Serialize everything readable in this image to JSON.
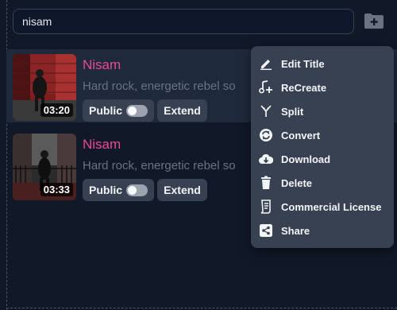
{
  "search": {
    "value": "nisam"
  },
  "songs": [
    {
      "title": "Nisam",
      "description": "Hard rock, energetic rebel so",
      "duration": "03:20",
      "visibility_label": "Public",
      "extend_label": "Extend",
      "public_on": false
    },
    {
      "title": "Nisam",
      "description": "Hard rock, energetic rebel so",
      "duration": "03:33",
      "visibility_label": "Public",
      "extend_label": "Extend",
      "public_on": false
    }
  ],
  "menu": {
    "items": [
      {
        "label": "Edit Title",
        "icon": "pencil-icon"
      },
      {
        "label": "ReCreate",
        "icon": "music-plus-icon"
      },
      {
        "label": "Split",
        "icon": "split-icon"
      },
      {
        "label": "Convert",
        "icon": "convert-icon"
      },
      {
        "label": "Download",
        "icon": "cloud-download-icon"
      },
      {
        "label": "Delete",
        "icon": "trash-icon"
      },
      {
        "label": "Commercial License",
        "icon": "license-icon"
      },
      {
        "label": "Share",
        "icon": "share-icon"
      }
    ]
  },
  "colors": {
    "accent_title": "#ec4899",
    "background": "#111827",
    "menu_bg": "#374151"
  }
}
